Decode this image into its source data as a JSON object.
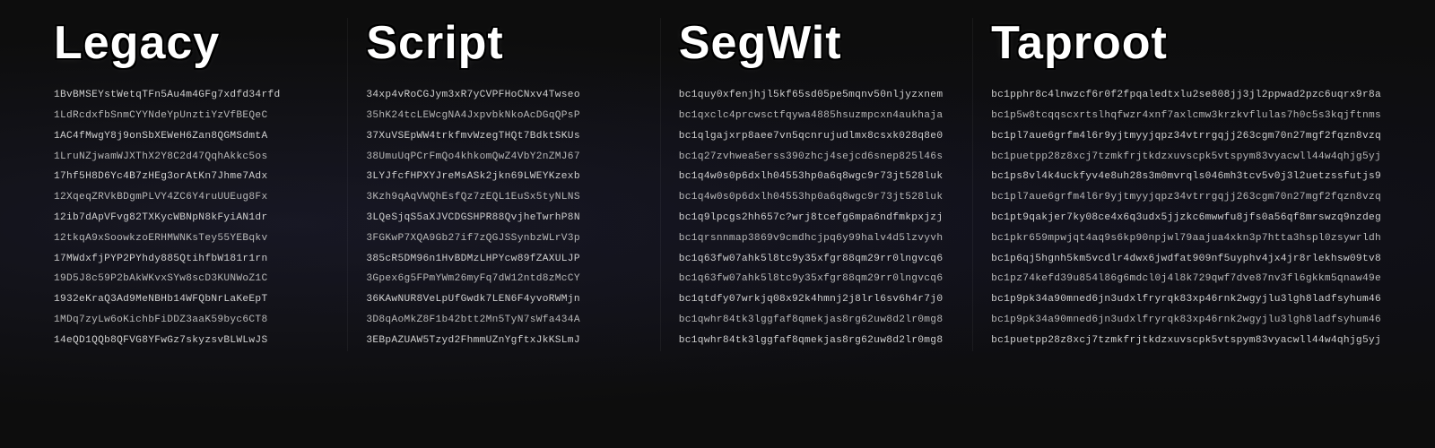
{
  "columns": [
    {
      "id": "legacy",
      "header": "Legacy",
      "addresses": [
        "1BvBMSEYstWetqTFn5Au4m4GFg7xdfd34rfd",
        "1LdRcdxfbSnmCYYNdeYpUnztiYzVfBEQeC",
        "1AC4fMwgY8j9onSbXEWeH6Zan8QGMSdmtA",
        "1LruNZjwamWJXThX2Y8C2d47QqhAkkc5os",
        "17hf5H8D6Yc4B7zHEg3orAtKn7Jhme7Adx",
        "12XqeqZRVkBDgmPLVY4ZC6Y4ruUUEug8Fx",
        "12ib7dApVFvg82TXKycWBNpN8kFyiAN1dr",
        "12tkqA9xSoowkzoERHMWNKsTey55YEBqkv",
        "17MWdxfjPYP2PYhdy885QtihfbW181r1rn",
        "19D5J8c59P2bAkWKvxSYw8scD3KUNWoZ1C",
        "1932eKraQ3Ad9MeNBHb14WFQbNrLaKeEpT",
        "1MDq7zyLw6oKichbFiDDZ3aaK59byc6CT8",
        "14eQD1QQb8QFVG8YFwGz7skyzsvBLWLwJS"
      ]
    },
    {
      "id": "script",
      "header": "Script",
      "addresses": [
        "34xp4vRoCGJym3xR7yCVPFHoCNxv4Twseo",
        "35hK24tcLEWcgNA4JxpvbkNkoAcDGqQPsP",
        "37XuVSEpWW4trkfmvWzegTHQt7BdktSKUs",
        "38UmuUqPCrFmQo4khkomQwZ4VbY2nZMJ67",
        "3LYJfcfHPXYJreMsASk2jkn69LWEYKzexb",
        "3Kzh9qAqVWQhEsfQz7zEQL1EuSx5tyNLNS",
        "3LQeSjqS5aXJVCDGSHPR88QvjheTwrhP8N",
        "3FGKwP7XQA9Gb27if7zQGJSSynbzWLrV3p",
        "385cR5DM96n1HvBDMzLHPYcw89fZAXULJP",
        "3Gpex6g5FPmYWm26myFq7dW12ntd8zMcCY",
        "36KAwNUR8VeLpUfGwdk7LEN6F4yvoRWMjn",
        "3D8qAoMkZ8F1b42btt2Mn5TyN7sWfa434A",
        "3EBpAZUAW5Tzyd2FhmmUZnYgftxJkKSLmJ"
      ]
    },
    {
      "id": "segwit",
      "header": "SegWit",
      "addresses": [
        "bc1quy0xfenjhjl5kf65sd05pe5mqnv50nljyzxnem",
        "bc1qxclc4prcwsctfqywa4885hsuzmpcxn4aukhaja",
        "bc1qlgajxrp8aee7vn5qcnrujudlmx8csxk028q8e0",
        "bc1q27zvhwea5erss390zhcj4sejcd6snep825l46s",
        "bc1q4w0s0p6dxlh04553hp0a6q8wgc9r73jt528luk",
        "bc1q4w0s0p6dxlh04553hp0a6q8wgc9r73jt528luk",
        "bc1q9lpcgs2hh657c?wrj8tcefg6mpa6ndfmkpxjzj",
        "bc1qrsnnmap3869v9cmdhcjpq6y99halv4d5lzvyvh",
        "bc1q63fw07ahk5l8tc9y35xfgr88qm29rr0lngvcq6",
        "bc1q63fw07ahk5l8tc9y35xfgr88qm29rr0lngvcq6",
        "bc1qtdfy07wrkjq08x92k4hmnj2j8lrl6sv6h4r7j0",
        "bc1qwhr84tk3lggfaf8qmekjas8rg62uw8d2lr0mg8",
        "bc1qwhr84tk3lggfaf8qmekjas8rg62uw8d2lr0mg8"
      ]
    },
    {
      "id": "taproot",
      "header": "Taproot",
      "addresses": [
        "bc1pphr8c4lnwzcf6r0f2fpqaledtxlu2se808jj3jl2ppwad2pzc6uqrx9r8a",
        "bc1p5w8tcqqscxrtslhqfwzr4xnf7axlcmw3krzkvflulas7h0c5s3kqjftnms",
        "bc1pl7aue6grfm4l6r9yjtmyyjqpz34vtrrgqjj263cgm70n27mgf2fqzn8vzq",
        "bc1puetpp28z8xcj7tzmkfrjtkdzxuvscpk5vtspym83vyacwll44w4qhjg5yj",
        "bc1ps8vl4k4uckfyv4e8uh28s3m0mvrqls046mh3tcv5v0j3l2uetzssfutjs9",
        "bc1pl7aue6grfm4l6r9yjtmyyjqpz34vtrrgqjj263cgm70n27mgf2fqzn8vzq",
        "bc1pt9qakjer7ky08ce4x6q3udx5jjzkc6mwwfu8jfs0a56qf8mrswzq9nzdeg",
        "bc1pkr659mpwjqt4aq9s6kp90npjwl79aajua4xkn3p7htta3hspl0zsywrldh",
        "bc1p6qj5hgnh5km5vcdlr4dwx6jwdfat909nf5uyphv4jx4jr8rlekhsw09tv8",
        "bc1pz74kefd39u854l86g6mdcl0j4l8k729qwf7dve87nv3fl6gkkm5qnaw49e",
        "bc1p9pk34a90mned6jn3udxlfryrqk83xp46rnk2wgyjlu3lgh8ladfsyhum46",
        "bc1p9pk34a90mned6jn3udxlfryrqk83xp46rnk2wgyjlu3lgh8ladfsyhum46",
        "bc1puetpp28z8xcj7tzmkfrjtkdzxuvscpk5vtspym83vyacwll44w4qhjg5yj"
      ]
    }
  ]
}
